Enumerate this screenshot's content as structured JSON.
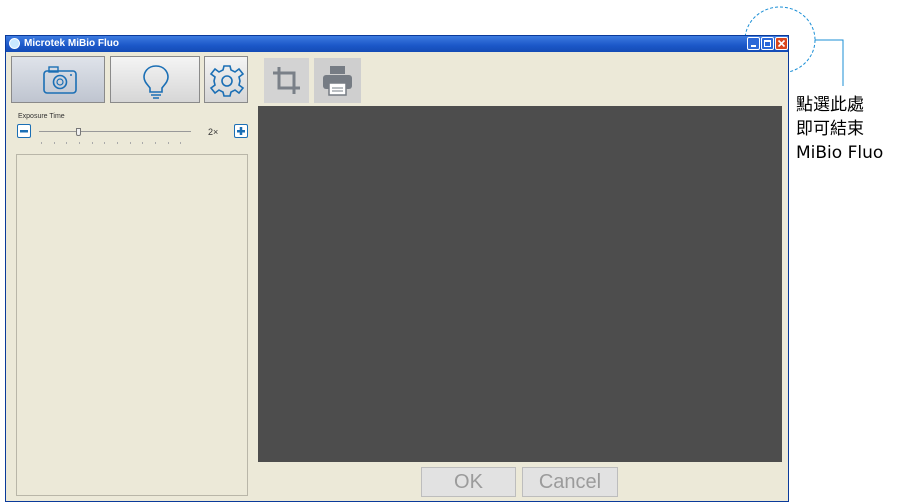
{
  "window": {
    "title": "Microtek MiBio Fluo",
    "controls": [
      "minimize-icon",
      "maximize-icon",
      "close-icon"
    ]
  },
  "left_toolbar": {
    "buttons": [
      {
        "icon": "camera-icon",
        "selected": true
      },
      {
        "icon": "lightbulb-icon",
        "selected": false
      },
      {
        "icon": "gear-icon",
        "selected": false
      }
    ]
  },
  "right_toolbar": {
    "buttons": [
      {
        "icon": "crop-icon"
      },
      {
        "icon": "printer-icon"
      }
    ]
  },
  "exposure": {
    "label": "Exposure Time",
    "value": "2×"
  },
  "dialog": {
    "ok_label": "OK",
    "cancel_label": "Cancel"
  },
  "annotation": {
    "line1": "點選此處",
    "line2": "即可結束",
    "line3": "MiBio Fluo"
  },
  "colors": {
    "accent": "#1b6fb5",
    "titlebar": "#1b57c8",
    "preview_bg": "#4d4d4d",
    "callout": "#1b8fd6"
  }
}
